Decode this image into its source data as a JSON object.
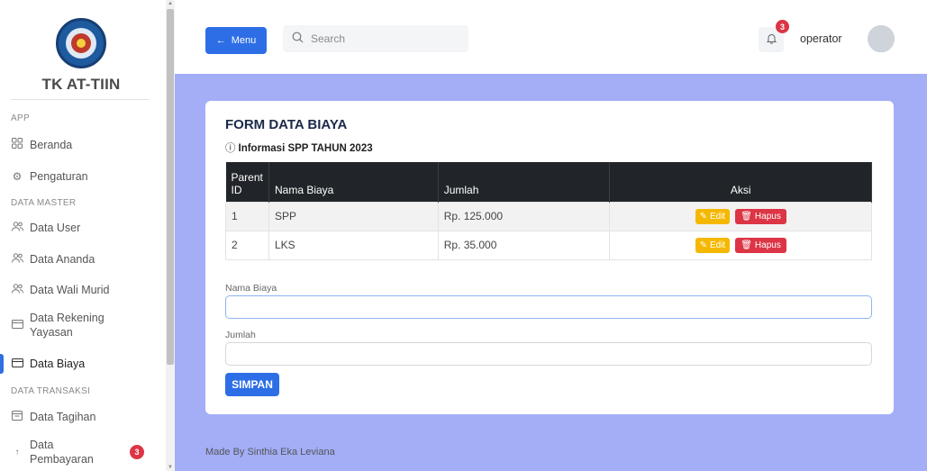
{
  "sidebar": {
    "brand": "TK AT-TIIN",
    "sections": {
      "app": "APP",
      "data_master": "DATA MASTER",
      "data_transaksi": "DATA TRANSAKSI"
    },
    "items": {
      "beranda": "Beranda",
      "pengaturan": "Pengaturan",
      "data_user": "Data User",
      "data_ananda": "Data Ananda",
      "data_wali_murid": "Data Wali Murid",
      "data_rekening_line1": "Data Rekening",
      "data_rekening_line2": "Yayasan",
      "data_biaya": "Data Biaya",
      "data_tagihan": "Data Tagihan",
      "data_pembayaran_line1": "Data",
      "data_pembayaran_line2": "Pembayaran",
      "data_pembayaran_badge": "3"
    }
  },
  "topbar": {
    "menu_label": "Menu",
    "menu_arrow": "←",
    "search_placeholder": "Search",
    "notification_count": "3",
    "user_name": "operator"
  },
  "form": {
    "title": "FORM DATA BIAYA",
    "subtitle": "Informasi SPP TAHUN 2023",
    "info_icon": "ⓘ",
    "table": {
      "headers": [
        "Parent ID",
        "Nama Biaya",
        "Jumlah",
        "Aksi"
      ],
      "rows": [
        {
          "id": "1",
          "nama": "SPP",
          "jumlah": "Rp. 125.000"
        },
        {
          "id": "2",
          "nama": "LKS",
          "jumlah": "Rp. 35.000"
        }
      ],
      "edit_label": "Edit",
      "hapus_label": "Hapus"
    },
    "nama_biaya_label": "Nama Biaya",
    "nama_biaya_value": "",
    "jumlah_label": "Jumlah",
    "jumlah_value": "",
    "submit_label": "SIMPAN"
  },
  "footer": "Made By Sinthia Eka Leviana",
  "colors": {
    "primary": "#2d6ee6",
    "main_bg": "#a3aef7",
    "table_header": "#212529",
    "edit": "#f5b800",
    "danger": "#dc3545"
  }
}
